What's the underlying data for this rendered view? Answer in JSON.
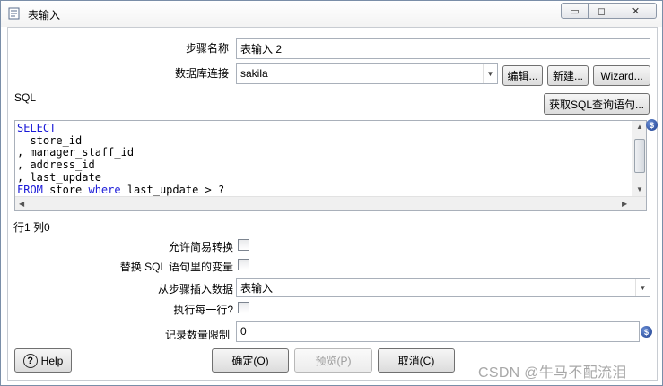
{
  "window": {
    "title": "表输入",
    "minimize_glyph": "▭",
    "maximize_glyph": "◻",
    "close_glyph": "✕"
  },
  "form": {
    "step_name_label": "步骤名称",
    "step_name_value": "表输入 2",
    "db_connection_label": "数据库连接",
    "db_connection_value": "sakila",
    "edit_button": "编辑...",
    "new_button": "新建...",
    "wizard_button": "Wizard...",
    "sql_label": "SQL",
    "get_sql_button": "获取SQL查询语句...",
    "sql_lines": [
      {
        "kw": "SELECT",
        "rest": ""
      },
      {
        "kw": "",
        "rest": "  store_id"
      },
      {
        "kw": "",
        "rest": ", manager_staff_id"
      },
      {
        "kw": "",
        "rest": ", address_id"
      },
      {
        "kw": "",
        "rest": ", last_update"
      },
      {
        "kw": "FROM",
        "mid": " store ",
        "kw2": "where",
        "rest": " last_update > ?"
      }
    ],
    "cursor_position": "行1 列0",
    "lazy_conversion_label": "允许简易转换",
    "lazy_conversion_checked": false,
    "replace_variables_label": "替换 SQL 语句里的变量",
    "replace_variables_checked": false,
    "insert_from_step_label": "从步骤插入数据",
    "insert_from_step_value": "表输入",
    "execute_each_row_label": "执行每一行?",
    "execute_each_row_checked": false,
    "limit_label": "记录数量限制",
    "limit_value": "0"
  },
  "footer": {
    "help_button": "Help",
    "ok_button": "确定(O)",
    "preview_button": "预览(P)",
    "cancel_button": "取消(C)"
  },
  "watermark": "CSDN @牛马不配流泪",
  "icons": {
    "variable_icon_glyph": "$",
    "help_icon_glyph": "?",
    "dropdown_glyph": "▼",
    "scroll_up_glyph": "▲",
    "scroll_down_glyph": "▼",
    "scroll_left_glyph": "◀",
    "scroll_right_glyph": "▶"
  },
  "colors": {
    "sql_keyword": "#1a1ad8",
    "variable_icon": "#1f3f8f"
  }
}
